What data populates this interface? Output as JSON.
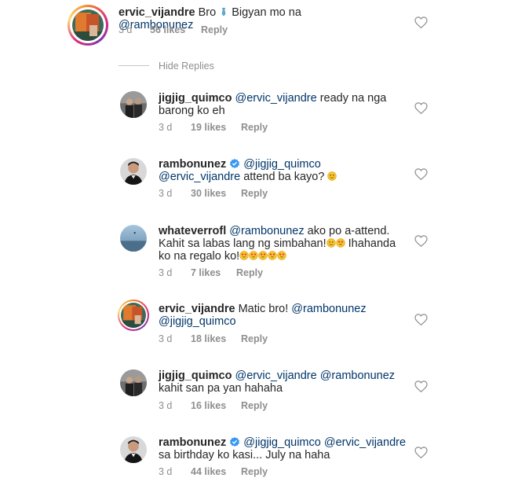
{
  "top_comment": {
    "username": "ervic_vijandre",
    "text_before": "Bro",
    "text_middle": "Bigyan mo na",
    "mention": "@rambonunez",
    "time": "3 d",
    "likes": "56 likes",
    "reply": "Reply"
  },
  "hide_replies": "Hide Replies",
  "replies": [
    {
      "username": "jigjig_quimco",
      "mention1": "@ervic_vijandre",
      "text": "ready na nga barong ko eh",
      "time": "3 d",
      "likes": "19 likes",
      "reply": "Reply"
    },
    {
      "username": "rambonunez",
      "mention1": "@jigjig_quimco",
      "mention2": "@ervic_vijandre",
      "text": "attend ba kayo?",
      "time": "3 d",
      "likes": "30 likes",
      "reply": "Reply"
    },
    {
      "username": "whateverrofl",
      "mention1": "@rambonunez",
      "text_a": "ako po a-attend. Kahit sa labas lang ng simbahan!",
      "text_b": "Ihahanda ko na regalo ko!",
      "time": "3 d",
      "likes": "7 likes",
      "reply": "Reply"
    },
    {
      "username": "ervic_vijandre",
      "text": "Matic bro!",
      "mention1": "@rambonunez",
      "mention2": "@jigjig_quimco",
      "time": "3 d",
      "likes": "18 likes",
      "reply": "Reply"
    },
    {
      "username": "jigjig_quimco",
      "mention1": "@ervic_vijandre",
      "mention2": "@rambonunez",
      "text": "kahit san pa yan hahaha",
      "time": "3 d",
      "likes": "16 likes",
      "reply": "Reply"
    },
    {
      "username": "rambonunez",
      "mention1": "@jigjig_quimco",
      "mention2": "@ervic_vijandre",
      "text": "sa birthday ko kasi... July na haha",
      "time": "3 d",
      "likes": "44 likes",
      "reply": "Reply"
    }
  ],
  "colors": {
    "mention": "#003569",
    "meta": "#8e8e8e",
    "verified": "#3897f0"
  },
  "icons": [
    "heart-outline-icon",
    "verified-badge-icon",
    "tie-emoji-icon",
    "smirk-emoji-icon",
    "heart-eyes-emoji-icon",
    "grin-emoji-icon"
  ]
}
